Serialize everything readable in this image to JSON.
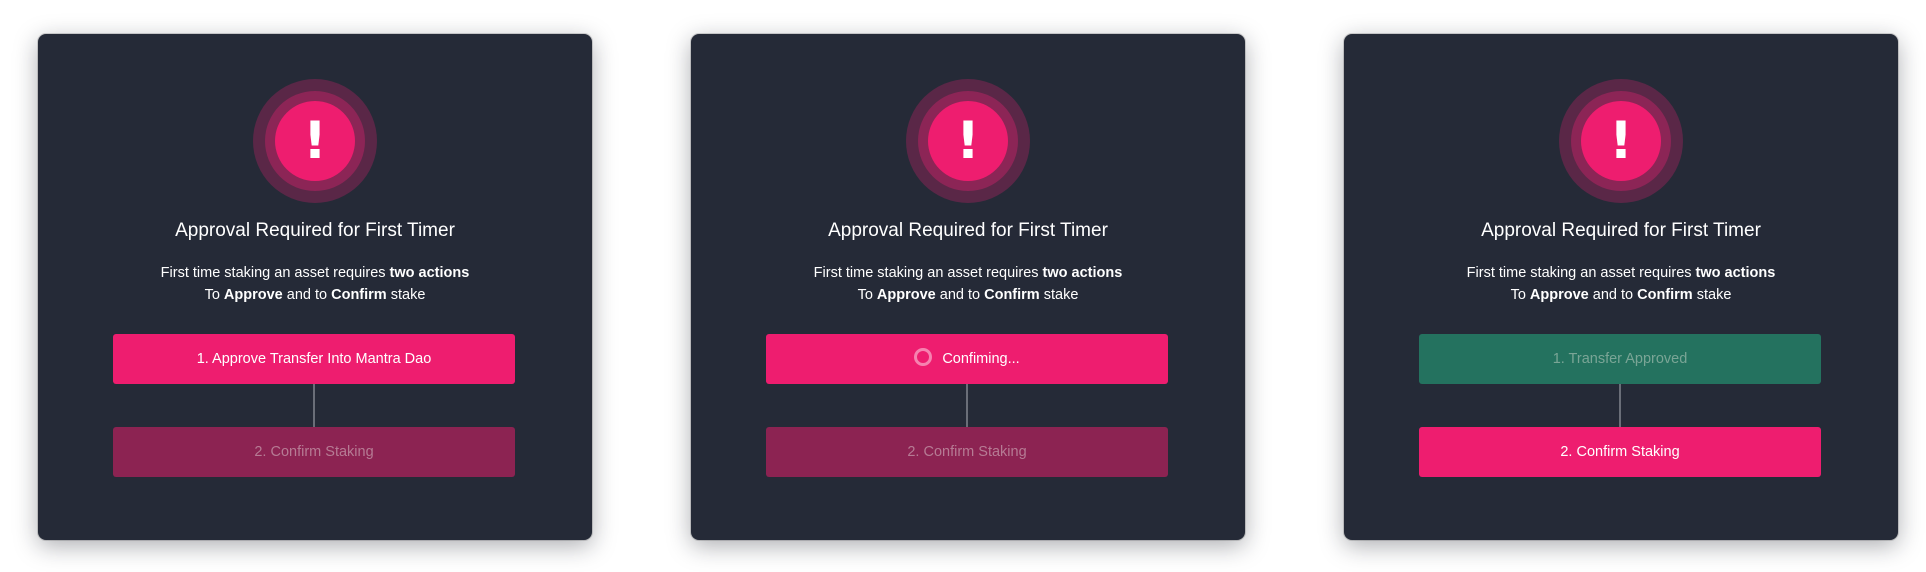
{
  "colors": {
    "card_bg": "#252a37",
    "accent_pink": "#ee1d6f",
    "muted_pink": "#8c2352",
    "approved_green": "#24725f"
  },
  "icon": "alert-exclamation-icon",
  "cards": [
    {
      "icon_glyph": "!",
      "title": "Approval Required for First Timer",
      "desc_line1_pre": "First time staking an asset requires ",
      "desc_line1_bold": "two actions",
      "desc_line2_pre": "To ",
      "desc_line2_bold1": "Approve",
      "desc_line2_mid": " and to ",
      "desc_line2_bold2": "Confirm",
      "desc_line2_post": " stake",
      "step1_label": "1. Approve Transfer Into Mantra Dao",
      "step2_label": "2. Confirm Staking"
    },
    {
      "icon_glyph": "!",
      "title": "Approval Required for First Timer",
      "desc_line1_pre": "First time staking an asset requires ",
      "desc_line1_bold": "two actions",
      "desc_line2_pre": "To ",
      "desc_line2_bold1": "Approve",
      "desc_line2_mid": " and to ",
      "desc_line2_bold2": "Confirm",
      "desc_line2_post": " stake",
      "step1_label": "Confiming...",
      "step2_label": "2. Confirm Staking"
    },
    {
      "icon_glyph": "!",
      "title": "Approval Required for First Timer",
      "desc_line1_pre": "First time staking an asset requires ",
      "desc_line1_bold": "two actions",
      "desc_line2_pre": "To ",
      "desc_line2_bold1": "Approve",
      "desc_line2_mid": " and to ",
      "desc_line2_bold2": "Confirm",
      "desc_line2_post": " stake",
      "step1_label": "1. Transfer Approved",
      "step2_label": "2. Confirm Staking"
    }
  ]
}
